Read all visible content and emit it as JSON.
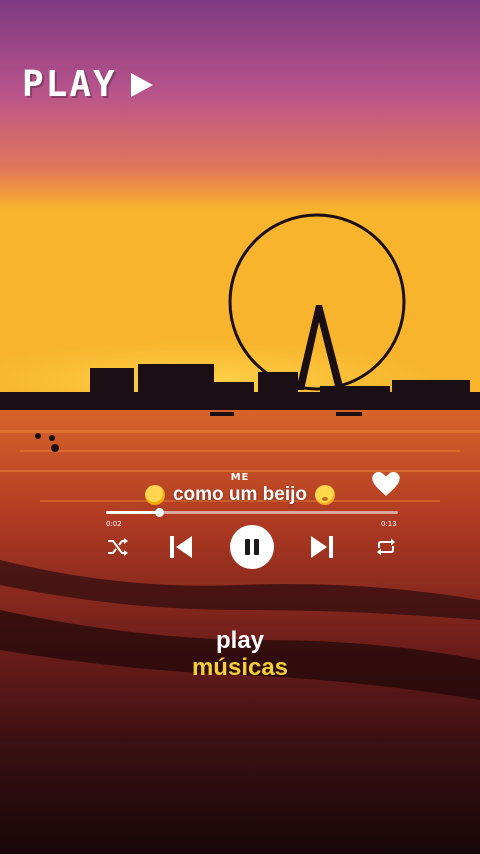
{
  "watermark": {
    "text": "PLAY",
    "icon": "play-triangle-icon"
  },
  "player": {
    "artist": "ME",
    "title": "como um beijo",
    "elapsed": "0:02",
    "remaining": "0:13",
    "progress_fraction": 0.18,
    "liked": true,
    "controls": {
      "shuffle": "shuffle-icon",
      "previous": "skip-previous-icon",
      "play_pause": "pause-icon",
      "next": "skip-next-icon",
      "repeat": "repeat-icon"
    }
  },
  "branding": {
    "line1": "play",
    "line2": "músicas",
    "line2_color": "#f3cf3a"
  },
  "colors": {
    "sky_top": "#9a3d83",
    "sky_mid": "#e97a4b",
    "horizon": "#f6b12e",
    "sea": "#6b1b17",
    "sand": "#1f0c0e"
  }
}
